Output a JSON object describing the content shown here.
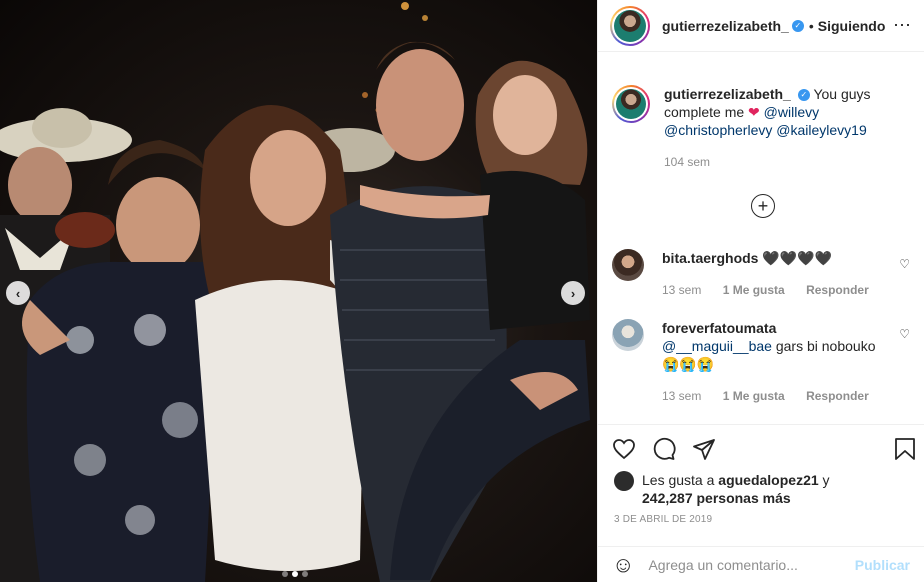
{
  "post": {
    "author": "gutierrezelizabeth_",
    "follow_sep": "•",
    "follow_label": "Siguiendo",
    "caption_author": "gutierrezelizabeth_",
    "caption_text": "You guys complete me",
    "caption_mentions": [
      "@willevy",
      "@christopherlevy",
      "@kaileylevy19"
    ],
    "caption_time": "104 sem",
    "load_more_label": "+",
    "carousel": {
      "total": 3,
      "active_index": 1
    },
    "nav_left": "‹",
    "nav_right": "›"
  },
  "comments": [
    {
      "user": "bita.taerghods",
      "text": "🖤🖤🖤🖤",
      "time": "13 sem",
      "likes": "1 Me gusta",
      "reply": "Responder"
    },
    {
      "user": "foreverfatoumata",
      "text_mention": "@__maguii__bae",
      "text": "gars bi nobouko",
      "emojis": "😭😭😭",
      "time": "13 sem",
      "likes": "1 Me gusta",
      "reply": "Responder"
    }
  ],
  "likes": {
    "prefix": "Les gusta a",
    "user": "aguedalopez21",
    "connector": "y",
    "count": "242,287",
    "suffix": "personas más"
  },
  "date": "3 DE ABRIL DE 2019",
  "add_comment": {
    "placeholder": "Agrega un comentario...",
    "post_label": "Publicar",
    "emoji_icon": "☺"
  },
  "colors": {
    "accent": "#3897f0",
    "link": "#00376b",
    "muted": "#8e8e8e",
    "heart": "#e0245e"
  }
}
